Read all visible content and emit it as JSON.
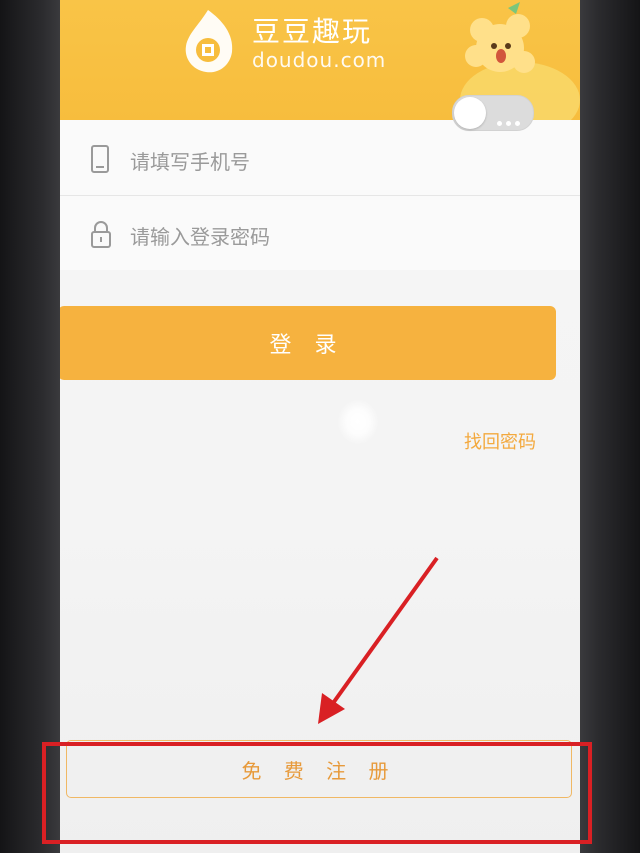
{
  "header": {
    "brand_name": "豆豆趣玩",
    "brand_domain": "doudou.com",
    "accent_color": "#f7bd3d"
  },
  "form": {
    "phone_placeholder": "请填写手机号",
    "password_placeholder": "请输入登录密码",
    "password_visibility_toggle": "off"
  },
  "actions": {
    "login_label": "登 录",
    "forgot_label": "找回密码",
    "register_label": "免 费 注 册",
    "button_color": "#f6b23f"
  },
  "annotation": {
    "highlight_color": "#d92024",
    "icons": [
      "arrow-icon",
      "highlight-box"
    ]
  }
}
